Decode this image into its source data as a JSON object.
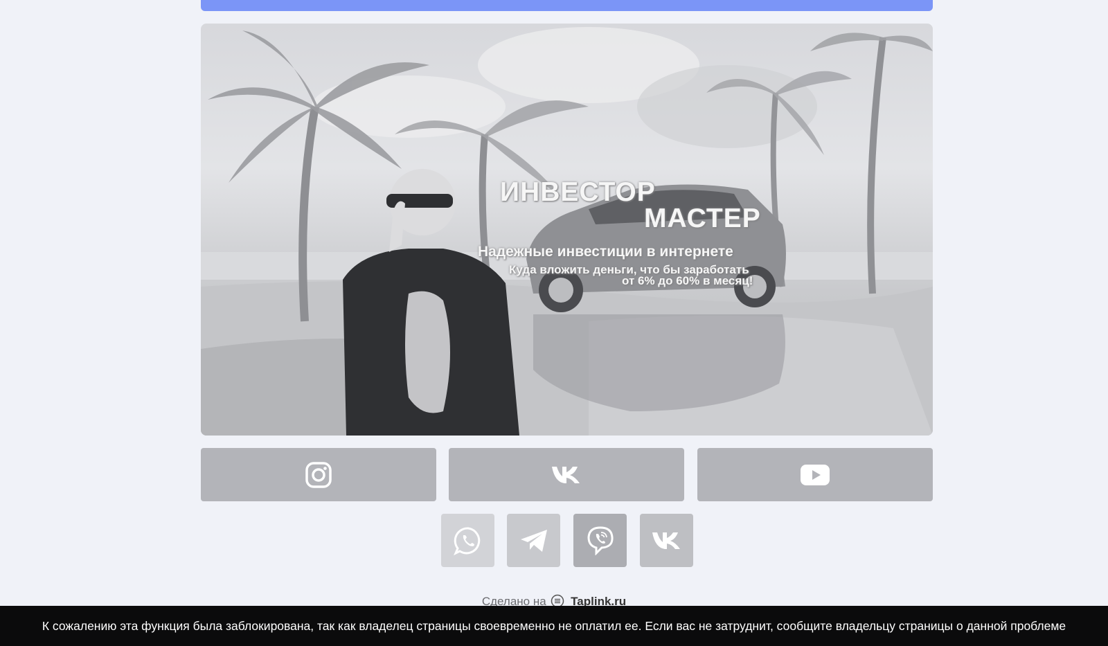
{
  "banner": {
    "title_line1": "ИНВЕСТОР",
    "title_line2": "МАСТЕР",
    "subtitle": "Надежные инвестиции в интернете",
    "line1": "Куда вложить деньги, что бы заработать",
    "line2": "от 6% до 60% в месяц!"
  },
  "social_buttons": [
    {
      "icon": "instagram-icon"
    },
    {
      "icon": "vk-icon"
    },
    {
      "icon": "youtube-icon"
    }
  ],
  "messenger_buttons": [
    {
      "icon": "whatsapp-icon"
    },
    {
      "icon": "telegram-icon"
    },
    {
      "icon": "viber-icon"
    },
    {
      "icon": "vk-icon"
    }
  ],
  "footer": {
    "made_with": "Сделано на",
    "brand": "Taplink.ru"
  },
  "notice": {
    "text": "К сожалению эта функция была заблокирована, так как владелец страницы своевременно не оплатил ее. Если вас не затруднит, сообщите владельцу страницы о данной проблеме"
  },
  "colors": {
    "page_bg": "#f0f2f8",
    "top_bar": "#7b95f7",
    "button_gray": "#b3b4b9",
    "notice_bg": "#0b0b0c"
  }
}
